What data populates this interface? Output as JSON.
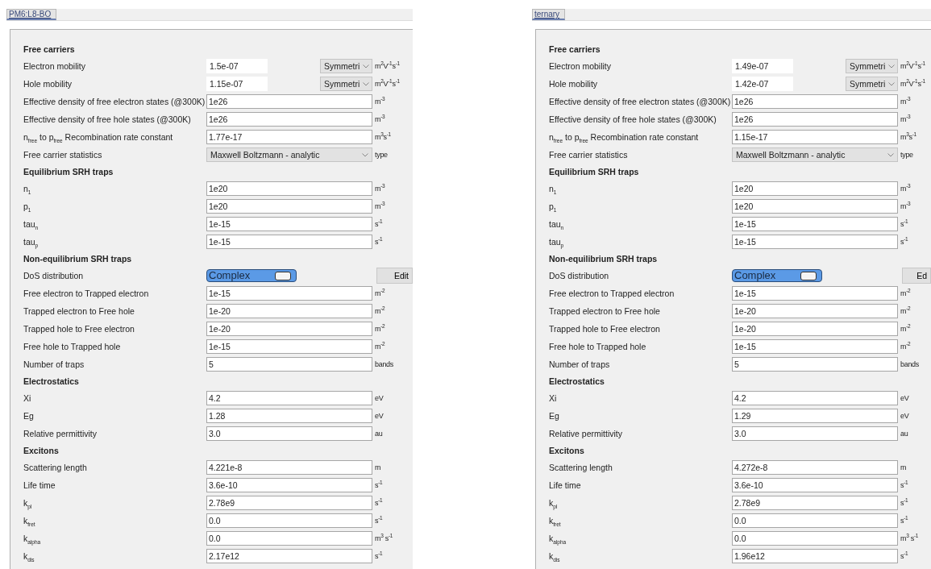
{
  "panels": [
    {
      "tab": "PM6:L8-BO",
      "sections": [
        {
          "title": "Free carriers",
          "rows": [
            {
              "kind": "mobility",
              "label": "Electron mobility",
              "value": "1.5e-07",
              "option": "Symmetri",
              "unit": "m$^{2}$V$^{-1}$s$^{-1}$"
            },
            {
              "kind": "mobility",
              "label": "Hole mobility",
              "value": "1.15e-07",
              "option": "Symmetri",
              "unit": "m$^{2}$V$^{-1}$s$^{-1}$"
            },
            {
              "kind": "field",
              "label": "Effective density of free electron states (@300K)",
              "value": "1e26",
              "unit": "m$^{-3}$"
            },
            {
              "kind": "field",
              "label": "Effective density of free hole states (@300K)",
              "value": "1e26",
              "unit": "m$^{-3}$"
            },
            {
              "kind": "field",
              "label": "n$_{free}$ to p$_{free}$ Recombination rate constant",
              "value": "1.77e-17",
              "unit": "m$^{3}$s$^{-1}$"
            },
            {
              "kind": "select",
              "label": "Free carrier statistics",
              "value": "Maxwell Boltzmann - analytic",
              "unit": "type"
            }
          ]
        },
        {
          "title": "Equilibrium SRH traps",
          "rows": [
            {
              "kind": "field",
              "label": "n$_{1}$",
              "value": "1e20",
              "unit": "m$^{-3}$"
            },
            {
              "kind": "field",
              "label": "p$_{1}$",
              "value": "1e20",
              "unit": "m$^{-3}$"
            },
            {
              "kind": "field",
              "label": "tau$_{n}$",
              "value": "1e-15",
              "unit": "s$^{-1}$"
            },
            {
              "kind": "field",
              "label": "tau$_{p}$",
              "value": "1e-15",
              "unit": "s$^{-1}$"
            }
          ]
        },
        {
          "title": "Non-equilibrium SRH traps",
          "rows": [
            {
              "kind": "toggle",
              "label": "DoS distribution",
              "value": "Complex",
              "on": true,
              "button": "Edit"
            },
            {
              "kind": "field",
              "label": "Free electron to Trapped electron",
              "value": "1e-15",
              "unit": "m$^{-2}$"
            },
            {
              "kind": "field",
              "label": "Trapped electron to Free hole",
              "value": "1e-20",
              "unit": "m$^{-2}$"
            },
            {
              "kind": "field",
              "label": "Trapped hole to Free electron",
              "value": "1e-20",
              "unit": "m$^{-2}$"
            },
            {
              "kind": "field",
              "label": "Free hole to Trapped hole",
              "value": "1e-15",
              "unit": "m$^{-2}$"
            },
            {
              "kind": "field",
              "label": "Number of traps",
              "value": "5",
              "unit": "bands"
            }
          ]
        },
        {
          "title": "Electrostatics",
          "rows": [
            {
              "kind": "field",
              "label": "Xi",
              "value": "4.2",
              "unit": "eV"
            },
            {
              "kind": "field",
              "label": "Eg",
              "value": "1.28",
              "unit": "eV"
            },
            {
              "kind": "field",
              "label": "Relative permittivity",
              "value": "3.0",
              "unit": "au"
            }
          ]
        },
        {
          "title": "Excitons",
          "rows": [
            {
              "kind": "field",
              "label": "Scattering length",
              "value": "4.221e-8",
              "unit": "m"
            },
            {
              "kind": "field",
              "label": "Life time",
              "value": "3.6e-10",
              "unit": "s$^{-1}$"
            },
            {
              "kind": "field",
              "label": "k$_{pl}$",
              "value": "2.78e9",
              "unit": "s$^{-1}$"
            },
            {
              "kind": "field",
              "label": "k$_{fret}$",
              "value": "0.0",
              "unit": "s$^{-1}$"
            },
            {
              "kind": "field",
              "label": "k$_{alpha}$",
              "value": "0.0",
              "unit": "m$^{3}$ s$^{-1}$"
            },
            {
              "kind": "field",
              "label": "k$_{dis}$",
              "value": "2.17e12",
              "unit": "s$^{-1}$"
            }
          ]
        }
      ]
    },
    {
      "tab": "ternary",
      "sections": [
        {
          "title": "Free carriers",
          "rows": [
            {
              "kind": "mobility",
              "label": "Electron mobility",
              "value": "1.49e-07",
              "option": "Symmetri",
              "unit": "m$^{2}$V$^{-1}$s$^{-1}$"
            },
            {
              "kind": "mobility",
              "label": "Hole mobility",
              "value": "1.42e-07",
              "option": "Symmetri",
              "unit": "m$^{2}$V$^{-1}$s$^{-1}$"
            },
            {
              "kind": "field",
              "label": "Effective density of free electron states (@300K)",
              "value": "1e26",
              "unit": "m$^{-3}$"
            },
            {
              "kind": "field",
              "label": "Effective density of free hole states (@300K)",
              "value": "1e26",
              "unit": "m$^{-3}$"
            },
            {
              "kind": "field",
              "label": "n$_{free}$ to p$_{free}$ Recombination rate constant",
              "value": "1.15e-17",
              "unit": "m$^{3}$s$^{-1}$"
            },
            {
              "kind": "select",
              "label": "Free carrier statistics",
              "value": "Maxwell Boltzmann - analytic",
              "unit": "type"
            }
          ]
        },
        {
          "title": "Equilibrium SRH traps",
          "rows": [
            {
              "kind": "field",
              "label": "n$_{1}$",
              "value": "1e20",
              "unit": "m$^{-3}$"
            },
            {
              "kind": "field",
              "label": "p$_{1}$",
              "value": "1e20",
              "unit": "m$^{-3}$"
            },
            {
              "kind": "field",
              "label": "tau$_{n}$",
              "value": "1e-15",
              "unit": "s$^{-1}$"
            },
            {
              "kind": "field",
              "label": "tau$_{p}$",
              "value": "1e-15",
              "unit": "s$^{-1}$"
            }
          ]
        },
        {
          "title": "Non-equilibrium SRH traps",
          "rows": [
            {
              "kind": "toggle",
              "label": "DoS distribution",
              "value": "Complex",
              "on": true,
              "button": "Ed"
            },
            {
              "kind": "field",
              "label": "Free electron to Trapped electron",
              "value": "1e-15",
              "unit": "m$^{-2}$"
            },
            {
              "kind": "field",
              "label": "Trapped electron to Free hole",
              "value": "1e-20",
              "unit": "m$^{-2}$"
            },
            {
              "kind": "field",
              "label": "Trapped hole to Free electron",
              "value": "1e-20",
              "unit": "m$^{-2}$"
            },
            {
              "kind": "field",
              "label": "Free hole to Trapped hole",
              "value": "1e-15",
              "unit": "m$^{-2}$"
            },
            {
              "kind": "field",
              "label": "Number of traps",
              "value": "5",
              "unit": "bands"
            }
          ]
        },
        {
          "title": "Electrostatics",
          "rows": [
            {
              "kind": "field",
              "label": "Xi",
              "value": "4.2",
              "unit": "eV"
            },
            {
              "kind": "field",
              "label": "Eg",
              "value": "1.29",
              "unit": "eV"
            },
            {
              "kind": "field",
              "label": "Relative permittivity",
              "value": "3.0",
              "unit": "au"
            }
          ]
        },
        {
          "title": "Excitons",
          "rows": [
            {
              "kind": "field",
              "label": "Scattering length",
              "value": "4.272e-8",
              "unit": "m"
            },
            {
              "kind": "field",
              "label": "Life time",
              "value": "3.6e-10",
              "unit": "s$^{-1}$"
            },
            {
              "kind": "field",
              "label": "k$_{pl}$",
              "value": "2.78e9",
              "unit": "s$^{-1}$"
            },
            {
              "kind": "field",
              "label": "k$_{fret}$",
              "value": "0.0",
              "unit": "s$^{-1}$"
            },
            {
              "kind": "field",
              "label": "k$_{alpha}$",
              "value": "0.0",
              "unit": "m$^{3}$ s$^{-1}$"
            },
            {
              "kind": "field",
              "label": "k$_{dis}$",
              "value": "1.96e12",
              "unit": "s$^{-1}$"
            }
          ]
        }
      ]
    }
  ]
}
